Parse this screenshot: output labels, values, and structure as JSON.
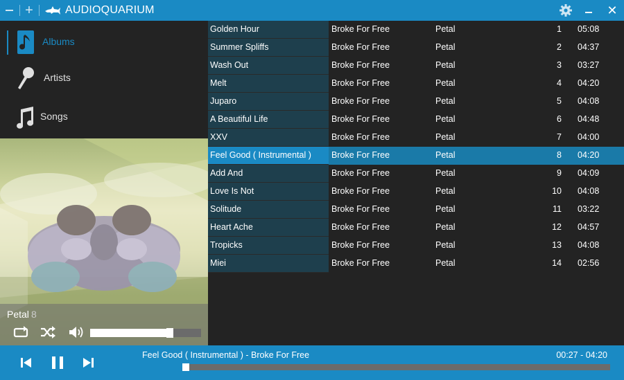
{
  "app": {
    "title": "AUDIOQUARIUM",
    "accent_color": "#1a8ac4",
    "icons": [
      "minimize-icon",
      "add-icon",
      "shark-logo-icon",
      "gear-icon",
      "minimize-window-icon",
      "close-icon"
    ]
  },
  "sidebar": {
    "items": [
      {
        "label": "Albums",
        "icon": "music-note-icon",
        "selected": true
      },
      {
        "label": "Artists",
        "icon": "microphone-icon",
        "selected": false
      },
      {
        "label": "Songs",
        "icon": "music-notes-icon",
        "selected": false
      }
    ]
  },
  "now_playing_panel": {
    "album": "Petal",
    "track_number": "8",
    "volume": 0.72,
    "controls": [
      "repeat-icon",
      "shuffle-icon",
      "volume-icon"
    ]
  },
  "tracks": [
    {
      "title": "Golden Hour",
      "artist": "Broke For Free",
      "album": "Petal",
      "number": "1",
      "duration": "05:08"
    },
    {
      "title": "Summer Spliffs",
      "artist": "Broke For Free",
      "album": "Petal",
      "number": "2",
      "duration": "04:37"
    },
    {
      "title": "Wash Out",
      "artist": "Broke For Free",
      "album": "Petal",
      "number": "3",
      "duration": "03:27"
    },
    {
      "title": "Melt",
      "artist": "Broke For Free",
      "album": "Petal",
      "number": "4",
      "duration": "04:20"
    },
    {
      "title": "Juparo",
      "artist": "Broke For Free",
      "album": "Petal",
      "number": "5",
      "duration": "04:08"
    },
    {
      "title": "A Beautiful Life",
      "artist": "Broke For Free",
      "album": "Petal",
      "number": "6",
      "duration": "04:48"
    },
    {
      "title": "XXV",
      "artist": "Broke For Free",
      "album": "Petal",
      "number": "7",
      "duration": "04:00"
    },
    {
      "title": "Feel Good ( Instrumental )",
      "artist": "Broke For Free",
      "album": "Petal",
      "number": "8",
      "duration": "04:20",
      "playing": true
    },
    {
      "title": "Add And",
      "artist": "Broke For Free",
      "album": "Petal",
      "number": "9",
      "duration": "04:09"
    },
    {
      "title": "Love Is Not",
      "artist": "Broke For Free",
      "album": "Petal",
      "number": "10",
      "duration": "04:08"
    },
    {
      "title": "Solitude",
      "artist": "Broke For Free",
      "album": "Petal",
      "number": "11",
      "duration": "03:22"
    },
    {
      "title": "Heart Ache",
      "artist": "Broke For Free",
      "album": "Petal",
      "number": "12",
      "duration": "04:57"
    },
    {
      "title": "Tropicks",
      "artist": "Broke For Free",
      "album": "Petal",
      "number": "13",
      "duration": "04:08"
    },
    {
      "title": "Miei",
      "artist": "Broke For Free",
      "album": "Petal",
      "number": "14",
      "duration": "02:56"
    }
  ],
  "player": {
    "current_track": "Feel Good ( Instrumental ) - Broke For Free",
    "time_display": "00:27 - 04:20",
    "progress": 0.1,
    "controls": [
      "previous-icon",
      "pause-icon",
      "next-icon"
    ]
  }
}
